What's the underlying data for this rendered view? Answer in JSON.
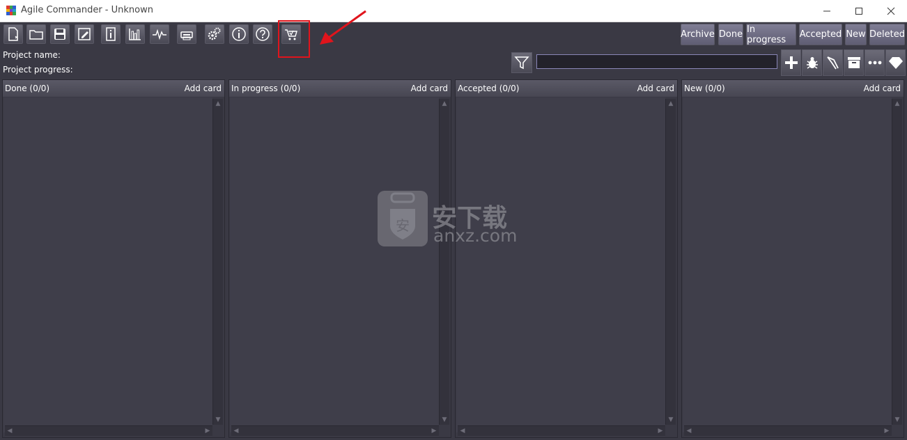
{
  "window": {
    "title": "Agile Commander - Unknown",
    "min_icon": "minimize-icon",
    "max_icon": "maximize-icon",
    "close_icon": "close-icon"
  },
  "toolbar": {
    "icons": [
      "new-document-icon",
      "open-folder-icon",
      "save-icon",
      "edit-icon",
      "info-panel-icon",
      "bar-chart-icon",
      "activity-icon",
      "print-icon",
      "settings-gears-icon",
      "about-icon",
      "help-icon",
      "shopping-cart-icon"
    ]
  },
  "project": {
    "name_label": "Project name:",
    "progress_label": "Project progress:"
  },
  "filters": {
    "archive": "Archive",
    "done": "Done",
    "in_progress": "In progress",
    "accepted": "Accepted",
    "new": "New",
    "deleted": "Deleted"
  },
  "search": {
    "value": "",
    "placeholder": ""
  },
  "action_icons": [
    "add-icon",
    "bug-icon",
    "tweezers-icon",
    "archive-box-icon",
    "more-icon",
    "diamond-icon"
  ],
  "columns": [
    {
      "title": "Done (0/0)",
      "add": "Add card"
    },
    {
      "title": "In progress (0/0)",
      "add": "Add card"
    },
    {
      "title": "Accepted (0/0)",
      "add": "Add card"
    },
    {
      "title": "New (0/0)",
      "add": "Add card"
    }
  ],
  "watermark": {
    "text": "安下载",
    "sub": "anxz.com",
    "badge": "安"
  },
  "colors": {
    "highlight": "#e0141c",
    "background": "#3a3944",
    "accent": "#8a86b8"
  }
}
